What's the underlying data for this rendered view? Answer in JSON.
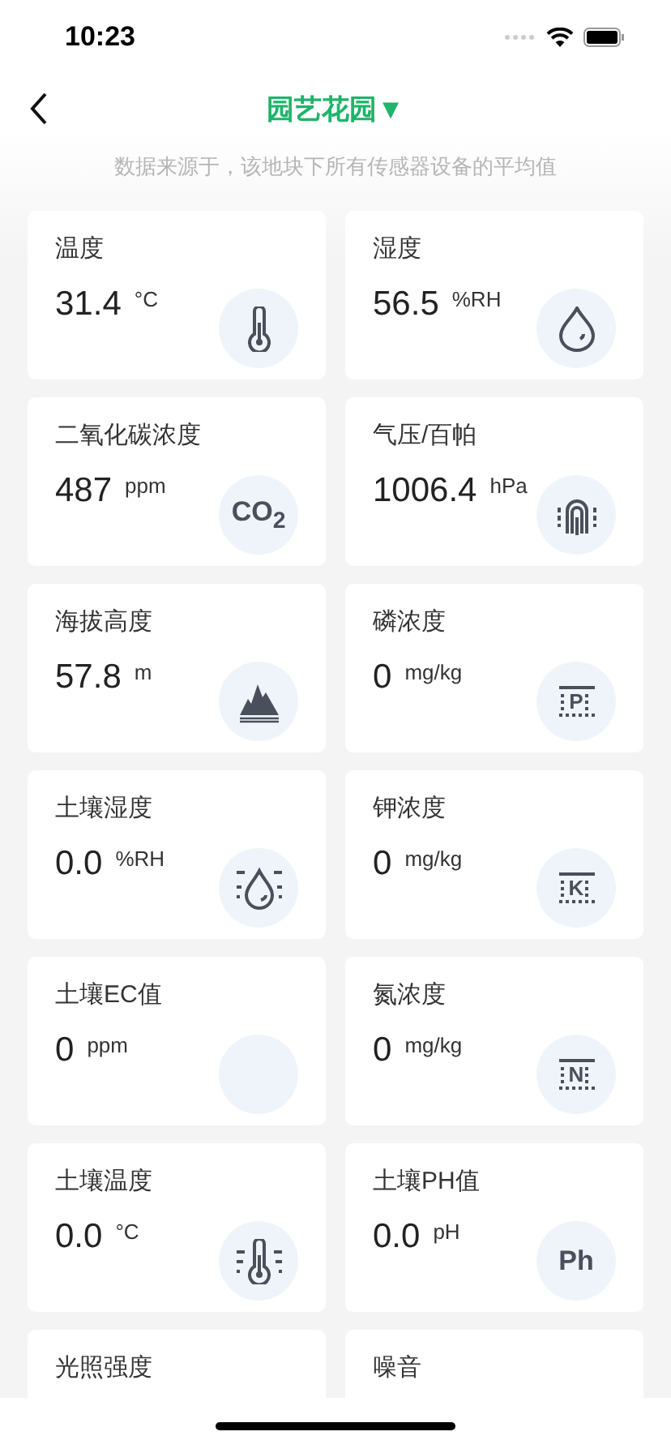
{
  "status_bar": {
    "time": "10:23"
  },
  "header": {
    "title": "园艺花园",
    "dropdown_glyph": "▼",
    "subtitle": "数据来源于，该地块下所有传感器设备的平均值"
  },
  "cards": [
    {
      "label": "温度",
      "value": "31.4",
      "unit": "°C",
      "icon": {
        "kind": "thermometer"
      }
    },
    {
      "label": "湿度",
      "value": "56.5",
      "unit": "%RH",
      "icon": {
        "kind": "drop"
      }
    },
    {
      "label": "二氧化碳浓度",
      "value": "487",
      "unit": "ppm",
      "icon": {
        "kind": "text",
        "text": "CO$_{2}$"
      }
    },
    {
      "label": "气压/百帕",
      "value": "1006.4",
      "unit": "hPa",
      "icon": {
        "kind": "pressure"
      }
    },
    {
      "label": "海拔高度",
      "value": "57.8",
      "unit": "m",
      "icon": {
        "kind": "mountain"
      }
    },
    {
      "label": "磷浓度",
      "value": "0",
      "unit": "mg/kg",
      "icon": {
        "kind": "nutrient",
        "text": "P"
      }
    },
    {
      "label": "土壤湿度",
      "value": "0.0",
      "unit": "%RH",
      "icon": {
        "kind": "soil-drop"
      }
    },
    {
      "label": "钾浓度",
      "value": "0",
      "unit": "mg/kg",
      "icon": {
        "kind": "nutrient",
        "text": "K"
      }
    },
    {
      "label": "土壤EC值",
      "value": "0",
      "unit": "ppm",
      "icon": {
        "kind": "none"
      }
    },
    {
      "label": "氮浓度",
      "value": "0",
      "unit": "mg/kg",
      "icon": {
        "kind": "nutrient",
        "text": "N"
      }
    },
    {
      "label": "土壤温度",
      "value": "0.0",
      "unit": "°C",
      "icon": {
        "kind": "soil-thermometer"
      }
    },
    {
      "label": "土壤PH值",
      "value": "0.0",
      "unit": "pH",
      "icon": {
        "kind": "text",
        "text": "Ph"
      }
    },
    {
      "label": "光照强度"
    },
    {
      "label": "噪音"
    }
  ]
}
